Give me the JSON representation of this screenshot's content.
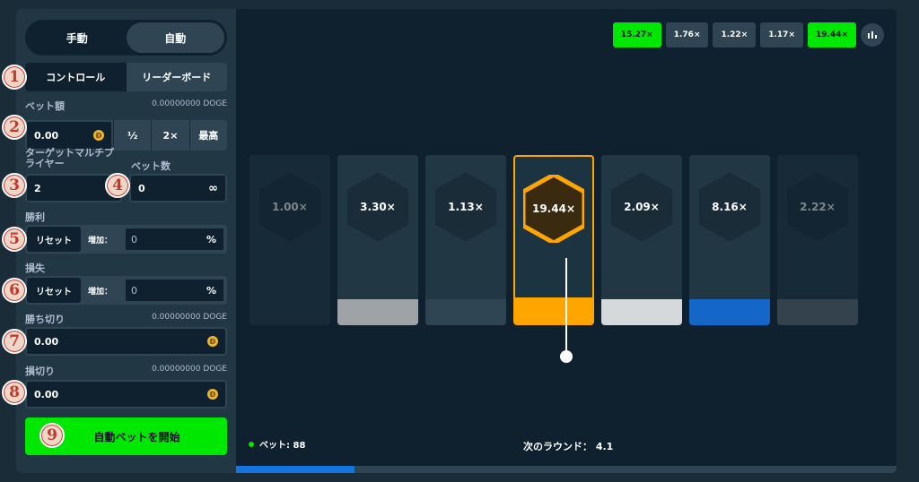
{
  "mode_toggle": {
    "manual": "手動",
    "auto": "自動"
  },
  "tabs": {
    "control": "コントロール",
    "leaderboard": "リーダーボード"
  },
  "bet": {
    "label": "ベット額",
    "balance": "0.00000000 DOGE",
    "value": "0.00",
    "half": "½",
    "double": "2×",
    "max": "最高"
  },
  "target": {
    "label": "ターゲットマルチプライヤー",
    "label_line1": "ターゲットマルチプ",
    "label_line2": "ライヤー",
    "value": "2"
  },
  "bet_count": {
    "label": "ベット数",
    "value": "0",
    "infinity": "∞"
  },
  "on_win": {
    "label": "勝利",
    "reset": "リセット",
    "increase": "増加：",
    "value": "0",
    "pct": "%"
  },
  "on_loss": {
    "label": "損失",
    "reset": "リセット",
    "increase": "増加：",
    "value": "0",
    "pct": "%"
  },
  "stop_profit": {
    "label": "勝ち切り",
    "balance": "0.00000000 DOGE",
    "value": "0.00"
  },
  "stop_loss": {
    "label": "損切り",
    "balance": "0.00000000 DOGE",
    "value": "0.00"
  },
  "start_button": "自動ベットを開始",
  "badges": [
    "1",
    "2",
    "3",
    "4",
    "5",
    "6",
    "7",
    "8",
    "9"
  ],
  "history": [
    {
      "label": "15.27×",
      "win": true
    },
    {
      "label": "1.76×",
      "win": false
    },
    {
      "label": "1.22×",
      "win": false
    },
    {
      "label": "1.17×",
      "win": false
    },
    {
      "label": "19.44×",
      "win": true
    }
  ],
  "history_more_icon": "history-icon",
  "cards": [
    {
      "label": "1.00×",
      "bar_color": "#213743",
      "active": false,
      "dim": true
    },
    {
      "label": "3.30×",
      "bar_color": "#9ea3a8",
      "active": false,
      "dim": false
    },
    {
      "label": "1.13×",
      "bar_color": "#2f4553",
      "active": false,
      "dim": false
    },
    {
      "label": "19.44×",
      "bar_color": "#ffa500",
      "active": true,
      "dim": false
    },
    {
      "label": "2.09×",
      "bar_color": "#d5d9dc",
      "active": false,
      "dim": false
    },
    {
      "label": "8.16×",
      "bar_color": "#1466c9",
      "active": false,
      "dim": false
    },
    {
      "label": "2.22×",
      "bar_color": "#5f6c74",
      "active": false,
      "dim": true
    }
  ],
  "footer": {
    "bet_label": "ベット: 88",
    "next_round": "次のラウンド： 4.1",
    "progress": 0.18
  },
  "colors": {
    "accent_green": "#00e701",
    "accent_orange": "#ffa500",
    "panel": "#213743",
    "bg": "#0f212e"
  }
}
